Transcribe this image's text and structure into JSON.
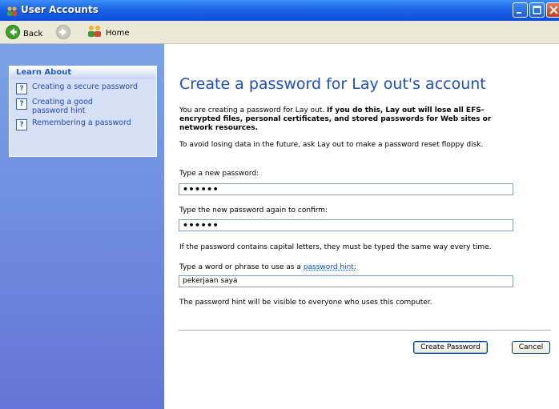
{
  "window": {
    "title": "User Accounts"
  },
  "toolbar": {
    "back_label": "Back",
    "home_label": "Home"
  },
  "sidebar": {
    "learn_about_title": "Learn About",
    "items": [
      {
        "label": "Creating a secure password",
        "icon": "help-question-icon"
      },
      {
        "label": "Creating a good password hint",
        "icon": "help-question-icon"
      },
      {
        "label": "Remembering a password",
        "icon": "help-question-icon"
      }
    ]
  },
  "main": {
    "heading": "Create a password for Lay out's account",
    "intro_prefix": "You are creating a password for Lay out. ",
    "intro_bold": "If you do this, Lay out will lose all EFS-encrypted files, personal certificates, and stored passwords for Web sites or network resources.",
    "avoid_text": "To avoid losing data in the future, ask Lay out to make a password reset floppy disk.",
    "new_password_label": "Type a new password:",
    "new_password_value": "••••••",
    "confirm_label": "Type the new password again to confirm:",
    "confirm_value": "••••••",
    "caps_note": "If the password contains capital letters, they must be typed the same way every time.",
    "hint_label_prefix": "Type a word or phrase to use as a ",
    "hint_label_link": "password hint:",
    "hint_value": "pekerjaan saya",
    "hint_visible_note": "The password hint will be visible to everyone who uses this computer.",
    "create_button_label": "Create Password",
    "cancel_button_label": "Cancel"
  },
  "colors": {
    "accent": "#1c4fc0",
    "sidebar_top": "#7ba2e7",
    "sidebar_bottom": "#6375d6"
  }
}
